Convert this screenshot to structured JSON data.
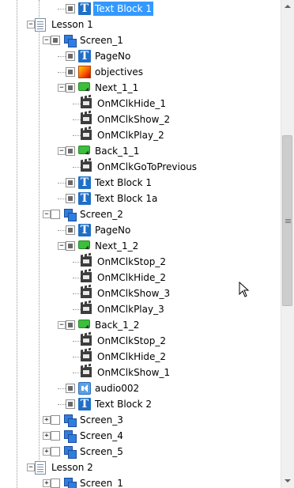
{
  "tree": {
    "rows": [
      {
        "label": "Text Block 1",
        "icon": "text-block-icon",
        "depth": 2,
        "checkbox": "part",
        "expander": "",
        "selected": true
      },
      {
        "label": "Lesson 1",
        "icon": "lesson-document-icon",
        "depth": 0,
        "checkbox": "none",
        "expander": "-"
      },
      {
        "label": "Screen_1",
        "icon": "screen-icon",
        "depth": 1,
        "checkbox": "part",
        "expander": "-"
      },
      {
        "label": "PageNo",
        "icon": "text-block-icon",
        "depth": 2,
        "checkbox": "part",
        "expander": ""
      },
      {
        "label": "objectives",
        "icon": "image-icon",
        "depth": 2,
        "checkbox": "part",
        "expander": ""
      },
      {
        "label": "Next_1_1",
        "icon": "button-icon",
        "depth": 2,
        "checkbox": "part",
        "expander": "-"
      },
      {
        "label": "OnMClkHide_1",
        "icon": "clapperboard-icon",
        "depth": 3,
        "checkbox": "none",
        "expander": ""
      },
      {
        "label": "OnMClkShow_2",
        "icon": "clapperboard-icon",
        "depth": 3,
        "checkbox": "none",
        "expander": ""
      },
      {
        "label": "OnMClkPlay_2",
        "icon": "clapperboard-icon",
        "depth": 3,
        "checkbox": "none",
        "expander": ""
      },
      {
        "label": "Back_1_1",
        "icon": "button-icon",
        "depth": 2,
        "checkbox": "part",
        "expander": "-"
      },
      {
        "label": "OnMClkGoToPrevious",
        "icon": "clapperboard-icon",
        "depth": 3,
        "checkbox": "none",
        "expander": ""
      },
      {
        "label": "Text Block 1",
        "icon": "text-block-icon",
        "depth": 2,
        "checkbox": "part",
        "expander": ""
      },
      {
        "label": "Text Block 1a",
        "icon": "text-block-icon",
        "depth": 2,
        "checkbox": "part",
        "expander": ""
      },
      {
        "label": "Screen_2",
        "icon": "screen-icon",
        "depth": 1,
        "checkbox": "empty",
        "expander": "-"
      },
      {
        "label": "PageNo",
        "icon": "text-block-icon",
        "depth": 2,
        "checkbox": "part",
        "expander": ""
      },
      {
        "label": "Next_1_2",
        "icon": "button-icon",
        "depth": 2,
        "checkbox": "part",
        "expander": "-"
      },
      {
        "label": "OnMClkStop_2",
        "icon": "clapperboard-icon",
        "depth": 3,
        "checkbox": "none",
        "expander": ""
      },
      {
        "label": "OnMClkHide_2",
        "icon": "clapperboard-icon",
        "depth": 3,
        "checkbox": "none",
        "expander": ""
      },
      {
        "label": "OnMClkShow_3",
        "icon": "clapperboard-icon",
        "depth": 3,
        "checkbox": "none",
        "expander": ""
      },
      {
        "label": "OnMClkPlay_3",
        "icon": "clapperboard-icon",
        "depth": 3,
        "checkbox": "none",
        "expander": ""
      },
      {
        "label": "Back_1_2",
        "icon": "button-icon",
        "depth": 2,
        "checkbox": "part",
        "expander": "-"
      },
      {
        "label": "OnMClkStop_2",
        "icon": "clapperboard-icon",
        "depth": 3,
        "checkbox": "none",
        "expander": ""
      },
      {
        "label": "OnMClkHide_2",
        "icon": "clapperboard-icon",
        "depth": 3,
        "checkbox": "none",
        "expander": ""
      },
      {
        "label": "OnMClkShow_1",
        "icon": "clapperboard-icon",
        "depth": 3,
        "checkbox": "none",
        "expander": ""
      },
      {
        "label": "audio002",
        "icon": "audio-icon",
        "depth": 2,
        "checkbox": "part",
        "expander": ""
      },
      {
        "label": "Text Block 2",
        "icon": "text-block-icon",
        "depth": 2,
        "checkbox": "part",
        "expander": ""
      },
      {
        "label": "Screen_3",
        "icon": "screen-icon",
        "depth": 1,
        "checkbox": "empty",
        "expander": "+"
      },
      {
        "label": "Screen_4",
        "icon": "screen-icon",
        "depth": 1,
        "checkbox": "empty",
        "expander": "+"
      },
      {
        "label": "Screen_5",
        "icon": "screen-icon",
        "depth": 1,
        "checkbox": "empty",
        "expander": "+"
      },
      {
        "label": "Lesson 2",
        "icon": "lesson-document-icon",
        "depth": 0,
        "checkbox": "none",
        "expander": "-"
      },
      {
        "label": "Screen_1",
        "icon": "screen-icon",
        "depth": 1,
        "checkbox": "empty",
        "expander": "+"
      }
    ]
  },
  "scrollbar": {
    "position": 0.42,
    "visible_fraction": 0.37
  },
  "colors": {
    "selection": "#3399ff",
    "text_block_icon": "#1f6fc5",
    "button_icon": "#3cbf3c"
  }
}
